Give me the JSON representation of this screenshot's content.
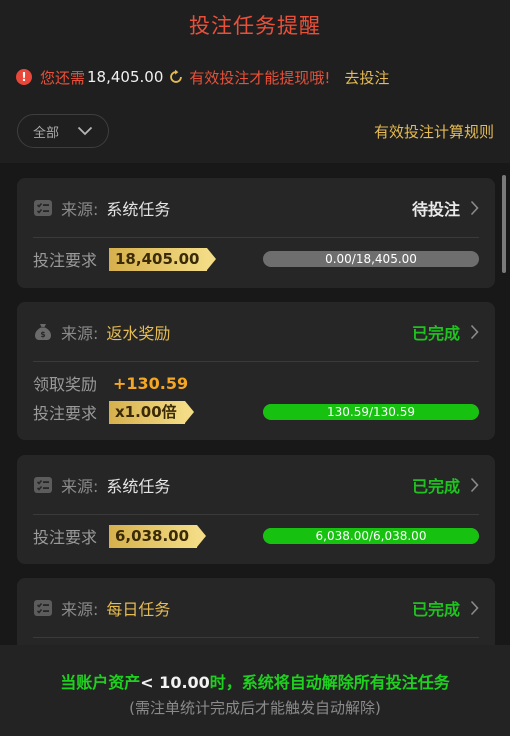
{
  "title": "投注任务提醒",
  "notice": {
    "prefix": "您还需",
    "amount": "18,405.00",
    "message": "有效投注才能提现哦!",
    "link": "去投注"
  },
  "filter": {
    "selected": "全部"
  },
  "rules_link": "有效投注计算规则",
  "tasks": [
    {
      "source_label": "来源:",
      "source_value": "系统任务",
      "status": "待投注",
      "req_label": "投注要求",
      "req_value": "18,405.00",
      "progress_text": "0.00/18,405.00",
      "progress": 0
    },
    {
      "source_label": "来源:",
      "source_value": "返水奖励",
      "status": "已完成",
      "reward_label": "领取奖励",
      "reward_value": "+130.59",
      "req_label": "投注要求",
      "req_value": "x1.00倍",
      "progress_text": "130.59/130.59",
      "progress": 1
    },
    {
      "source_label": "来源:",
      "source_value": "系统任务",
      "status": "已完成",
      "req_label": "投注要求",
      "req_value": "6,038.00",
      "progress_text": "6,038.00/6,038.00",
      "progress": 1
    },
    {
      "source_label": "来源:",
      "source_value": "每日任务",
      "status": "已完成"
    }
  ],
  "footer": {
    "line1_a": "当账户资产",
    "line1_b": "< 10.00",
    "line1_c": "时，系统将自动解除所有投注任务",
    "line2": "(需注单统计完成后才能触发自动解除)"
  },
  "colors": {
    "accent_red": "#e8503a",
    "gold": "#e5bb52",
    "success_green": "#16c20f",
    "progress_track": "#6e6e6e"
  },
  "icons": [
    "warning-icon",
    "refresh-icon",
    "chevron-down-icon",
    "task-list-icon",
    "money-bag-icon",
    "chevron-right-icon"
  ]
}
